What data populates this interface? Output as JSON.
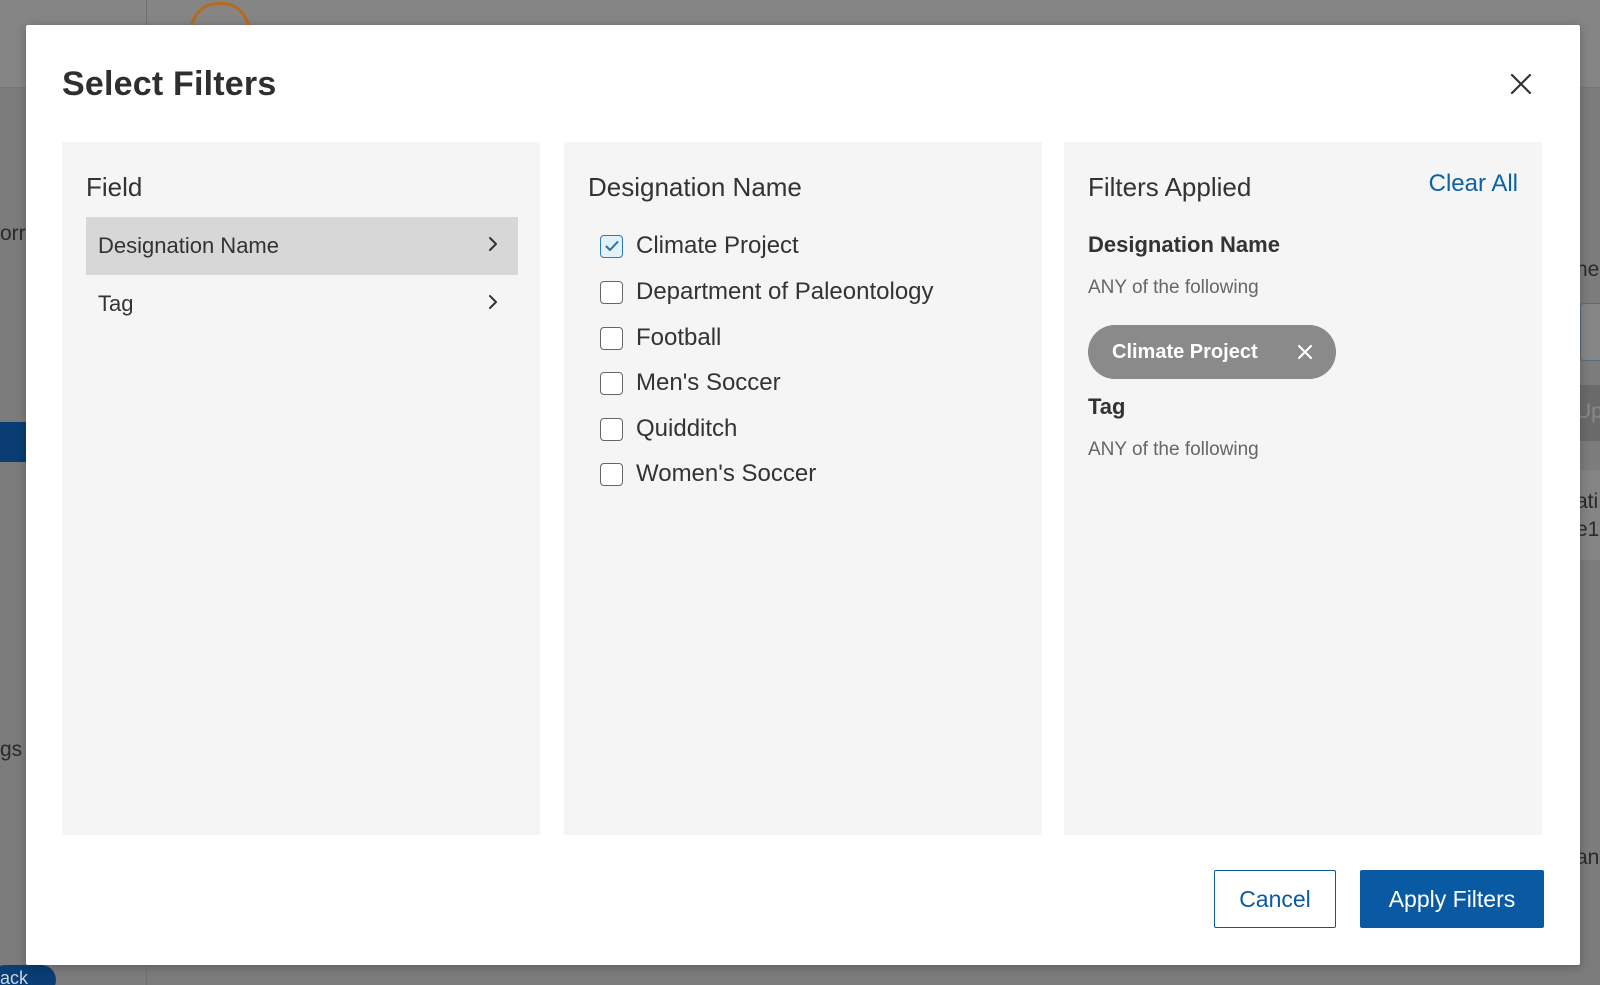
{
  "background": {
    "left_fragment_1": "orr",
    "left_fragment_2": "gs",
    "back_label": "ack",
    "right_fragment_1": "ner",
    "right_fragment_2": "Up",
    "right_fragment_3": "ati",
    "right_fragment_4": "e1",
    "right_fragment_5": "ani"
  },
  "modal": {
    "title": "Select Filters",
    "close_icon": "close-icon"
  },
  "field_panel": {
    "heading": "Field",
    "items": [
      {
        "label": "Designation Name",
        "active": true
      },
      {
        "label": "Tag",
        "active": false
      }
    ]
  },
  "options_panel": {
    "heading": "Designation Name",
    "options": [
      {
        "label": "Climate Project",
        "checked": true
      },
      {
        "label": "Department of Paleontology",
        "checked": false
      },
      {
        "label": "Football",
        "checked": false
      },
      {
        "label": "Men's Soccer",
        "checked": false
      },
      {
        "label": "Quidditch",
        "checked": false
      },
      {
        "label": "Women's Soccer",
        "checked": false
      }
    ]
  },
  "applied_panel": {
    "heading": "Filters Applied",
    "clear_all": "Clear All",
    "groups": [
      {
        "title": "Designation Name",
        "subtitle": "ANY of the following",
        "chips": [
          "Climate Project"
        ]
      },
      {
        "title": "Tag",
        "subtitle": "ANY of the following",
        "chips": []
      }
    ]
  },
  "footer": {
    "cancel_label": "Cancel",
    "apply_label": "Apply Filters"
  },
  "colors": {
    "accent": "#0a5aa3",
    "chip": "#8a8a8a",
    "panel_bg": "#f5f5f5",
    "checkbox_checked": "#2b7bb9"
  }
}
